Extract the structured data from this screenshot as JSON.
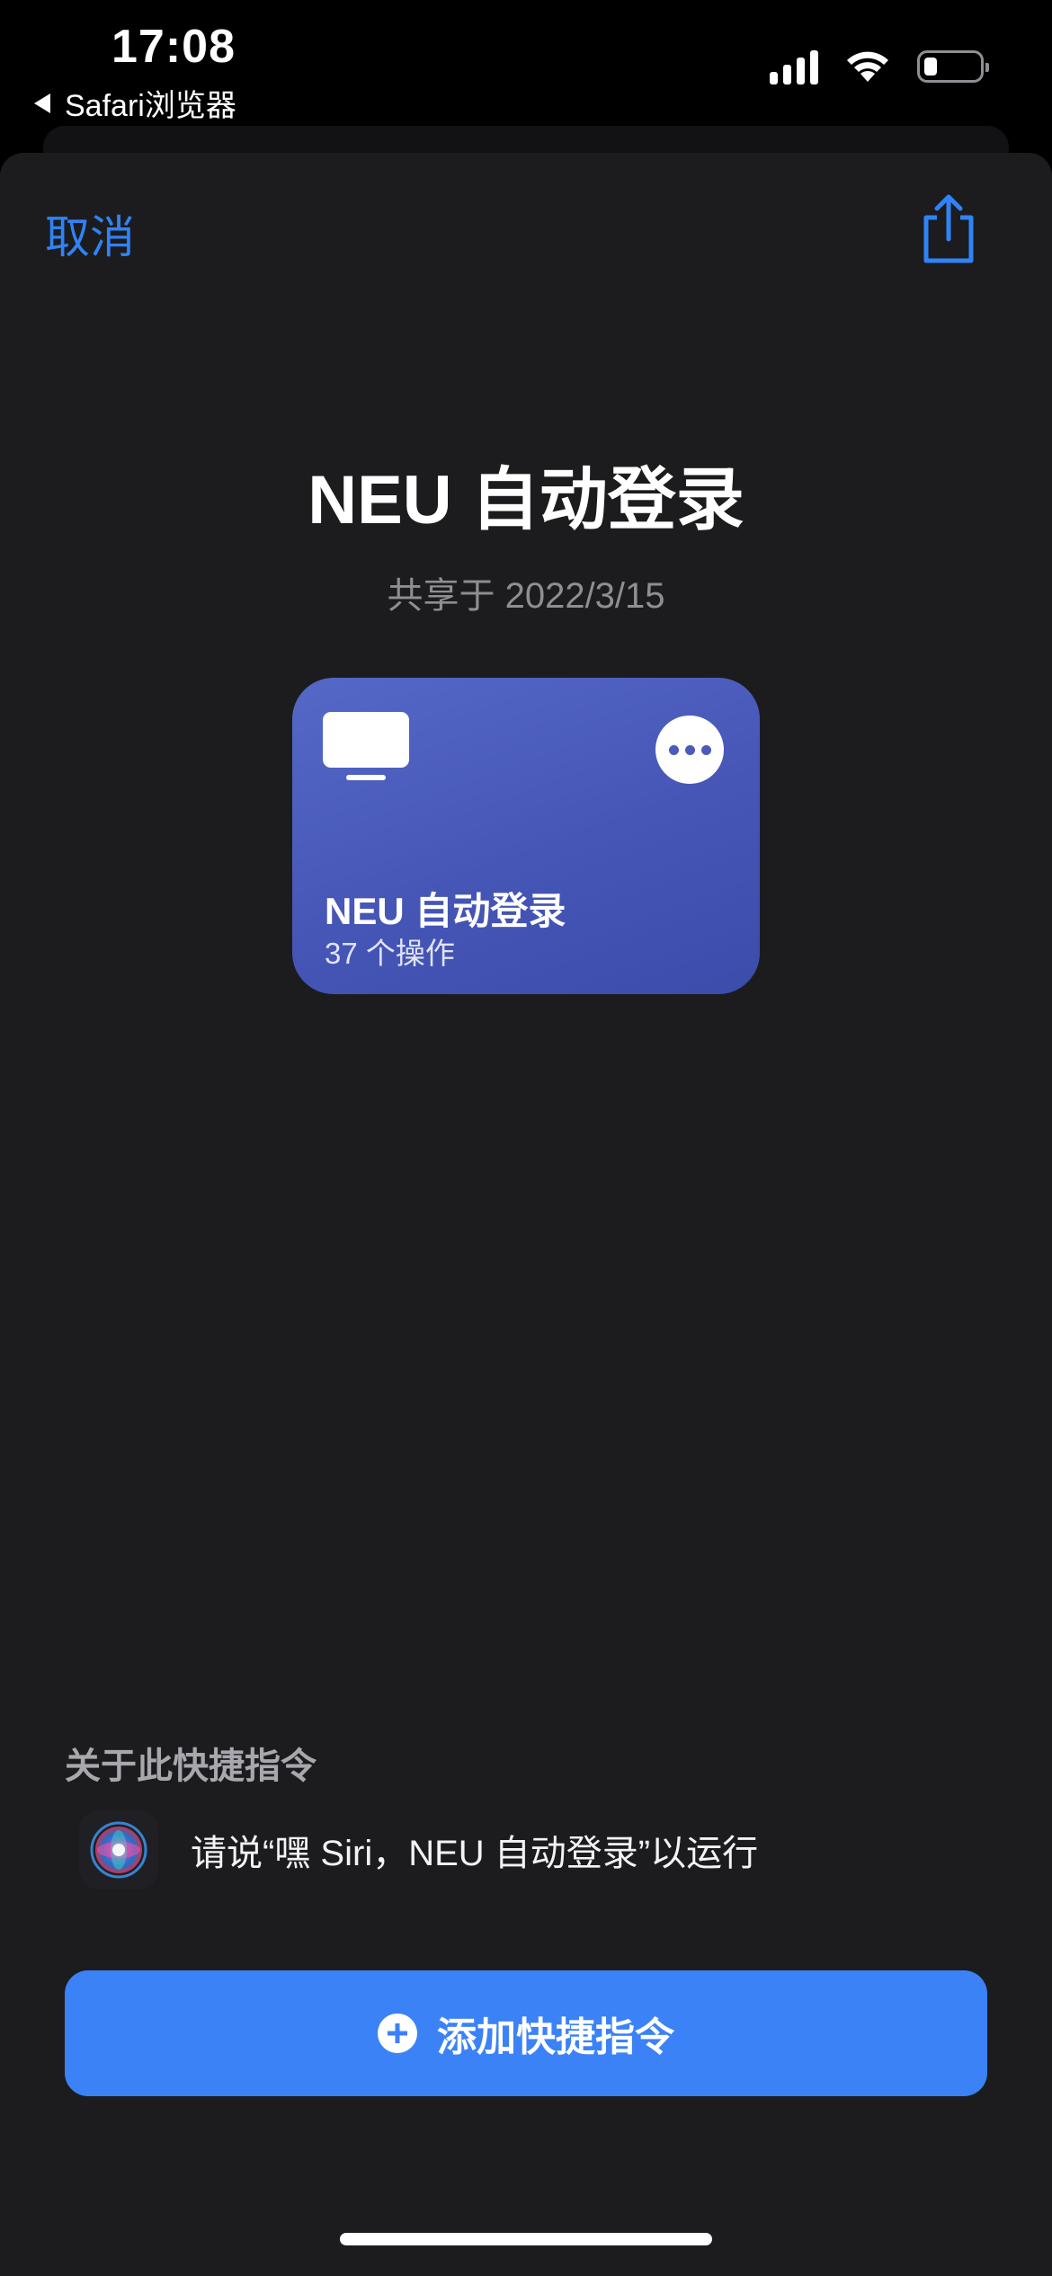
{
  "status_bar": {
    "time": "17:08",
    "back_app": "Safari浏览器",
    "battery_level_percent": 20
  },
  "header": {
    "cancel_label": "取消",
    "share_icon": "share-icon"
  },
  "shortcut": {
    "title": "NEU 自动登录",
    "shared_date": "共享于 2022/3/15",
    "card": {
      "name": "NEU 自动登录",
      "action_count": "37 个操作",
      "icon": "monitor-icon",
      "color": "#4656b6"
    }
  },
  "about": {
    "heading": "关于此快捷指令",
    "siri_phrase": "请说“嘿 Siri，NEU 自动登录”以运行"
  },
  "add_button": {
    "label": "添加快捷指令",
    "color": "#3b82f6"
  },
  "colors": {
    "accent": "#2f83f6",
    "sheet_background": "#1c1c1e"
  }
}
